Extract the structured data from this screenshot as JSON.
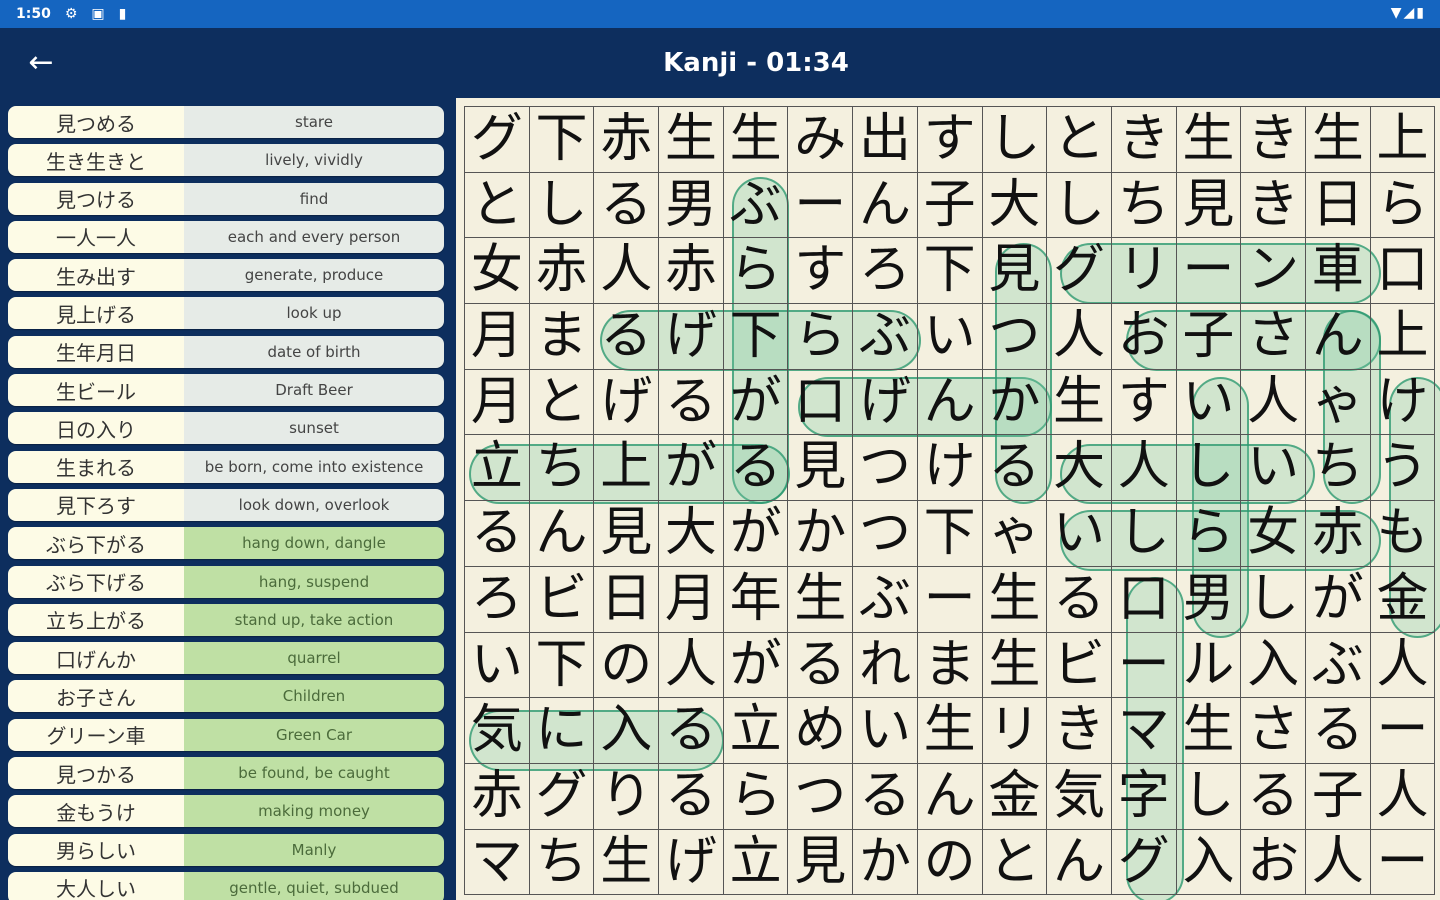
{
  "status": {
    "time": "1:50",
    "icons": [
      "gear-icon",
      "square-icon",
      "sd-card-icon"
    ],
    "right_icons": [
      "wifi-icon",
      "signal-icon",
      "battery-icon"
    ]
  },
  "appbar": {
    "title": "Kanji - 01:34",
    "back_icon": "arrow-left-icon"
  },
  "words": [
    {
      "jp": "見つめる",
      "en": "stare",
      "found": false
    },
    {
      "jp": "生き生きと",
      "en": "lively, vividly",
      "found": false
    },
    {
      "jp": "見つける",
      "en": "find",
      "found": false
    },
    {
      "jp": "一人一人",
      "en": "each and every person",
      "found": false
    },
    {
      "jp": "生み出す",
      "en": "generate, produce",
      "found": false
    },
    {
      "jp": "見上げる",
      "en": "look up",
      "found": false
    },
    {
      "jp": "生年月日",
      "en": "date of birth",
      "found": false
    },
    {
      "jp": "生ビール",
      "en": "Draft Beer",
      "found": false
    },
    {
      "jp": "日の入り",
      "en": "sunset",
      "found": false
    },
    {
      "jp": "生まれる",
      "en": "be born, come into existence",
      "found": false
    },
    {
      "jp": "見下ろす",
      "en": "look down, overlook",
      "found": false
    },
    {
      "jp": "ぶら下がる",
      "en": "hang down, dangle",
      "found": true
    },
    {
      "jp": "ぶら下げる",
      "en": "hang, suspend",
      "found": true
    },
    {
      "jp": "立ち上がる",
      "en": "stand up, take action",
      "found": true
    },
    {
      "jp": "口げんか",
      "en": "quarrel",
      "found": true
    },
    {
      "jp": "お子さん",
      "en": "Children",
      "found": true
    },
    {
      "jp": "グリーン車",
      "en": "Green Car",
      "found": true
    },
    {
      "jp": "見つかる",
      "en": "be found, be caught",
      "found": true
    },
    {
      "jp": "金もうけ",
      "en": "making money",
      "found": true
    },
    {
      "jp": "男らしい",
      "en": "Manly",
      "found": true
    },
    {
      "jp": "大人しい",
      "en": "gentle, quiet, subdued",
      "found": true
    }
  ],
  "grid": [
    [
      "グ",
      "下",
      "赤",
      "生",
      "生",
      "み",
      "出",
      "す",
      "し",
      "と",
      "き",
      "生",
      "き",
      "生",
      "上"
    ],
    [
      "と",
      "し",
      "る",
      "男",
      "ぶ",
      "ー",
      "ん",
      "子",
      "大",
      "し",
      "ち",
      "見",
      "き",
      "日",
      "ら"
    ],
    [
      "女",
      "赤",
      "人",
      "赤",
      "ら",
      "す",
      "ろ",
      "下",
      "見",
      "グ",
      "リ",
      "ー",
      "ン",
      "車",
      "口"
    ],
    [
      "月",
      "ま",
      "る",
      "げ",
      "下",
      "ら",
      "ぶ",
      "い",
      "つ",
      "人",
      "お",
      "子",
      "さ",
      "ん",
      "上"
    ],
    [
      "月",
      "と",
      "げ",
      "る",
      "が",
      "口",
      "げ",
      "ん",
      "か",
      "生",
      "す",
      "い",
      "人",
      "ゃ",
      "け"
    ],
    [
      "立",
      "ち",
      "上",
      "が",
      "る",
      "見",
      "つ",
      "け",
      "る",
      "大",
      "人",
      "し",
      "い",
      "ち",
      "う"
    ],
    [
      "る",
      "ん",
      "見",
      "大",
      "が",
      "か",
      "つ",
      "下",
      "ゃ",
      "い",
      "し",
      "ら",
      "女",
      "赤",
      "も"
    ],
    [
      "ろ",
      "ビ",
      "日",
      "月",
      "年",
      "生",
      "ぶ",
      "ー",
      "生",
      "る",
      "口",
      "男",
      "し",
      "が",
      "金"
    ],
    [
      "い",
      "下",
      "の",
      "人",
      "が",
      "る",
      "れ",
      "ま",
      "生",
      "ビ",
      "ー",
      "ル",
      "入",
      "ぶ",
      "人"
    ],
    [
      "気",
      "に",
      "入",
      "る",
      "立",
      "め",
      "い",
      "生",
      "リ",
      "き",
      "マ",
      "生",
      "さ",
      "る",
      "ー"
    ],
    [
      "赤",
      "グ",
      "り",
      "る",
      "ら",
      "つ",
      "る",
      "ん",
      "金",
      "気",
      "字",
      "し",
      "る",
      "子",
      "人"
    ],
    [
      "マ",
      "ち",
      "生",
      "げ",
      "立",
      "見",
      "か",
      "の",
      "と",
      "ん",
      "グ",
      "入",
      "お",
      "人",
      "ー"
    ]
  ],
  "highlights": [
    {
      "r": 1,
      "c": 4,
      "dr": 1,
      "dc": 0,
      "len": 5
    },
    {
      "r": 3,
      "c": 2,
      "dr": 0,
      "dc": 1,
      "len": 5
    },
    {
      "r": 5,
      "c": 0,
      "dr": 0,
      "dc": 1,
      "len": 5
    },
    {
      "r": 4,
      "c": 5,
      "dr": 0,
      "dc": 1,
      "len": 4
    },
    {
      "r": 3,
      "c": 10,
      "dr": 0,
      "dc": 1,
      "len": 4
    },
    {
      "r": 2,
      "c": 9,
      "dr": 0,
      "dc": 1,
      "len": 5
    },
    {
      "r": 2,
      "c": 8,
      "dr": 1,
      "dc": 0,
      "len": 4
    },
    {
      "r": 4,
      "c": 14,
      "dr": 1,
      "dc": 0,
      "len": 4
    },
    {
      "r": 4,
      "c": 11,
      "dr": 1,
      "dc": 0,
      "len": 4
    },
    {
      "r": 5,
      "c": 9,
      "dr": 0,
      "dc": 1,
      "len": 4
    },
    {
      "r": 3,
      "c": 13,
      "dr": 1,
      "dc": 0,
      "len": 3
    },
    {
      "r": 6,
      "c": 9,
      "dr": 0,
      "dc": 1,
      "len": 5
    },
    {
      "r": 7,
      "c": 10,
      "dr": 1,
      "dc": 0,
      "len": 5
    },
    {
      "r": 9,
      "c": 0,
      "dr": 0,
      "dc": 1,
      "len": 4
    }
  ]
}
